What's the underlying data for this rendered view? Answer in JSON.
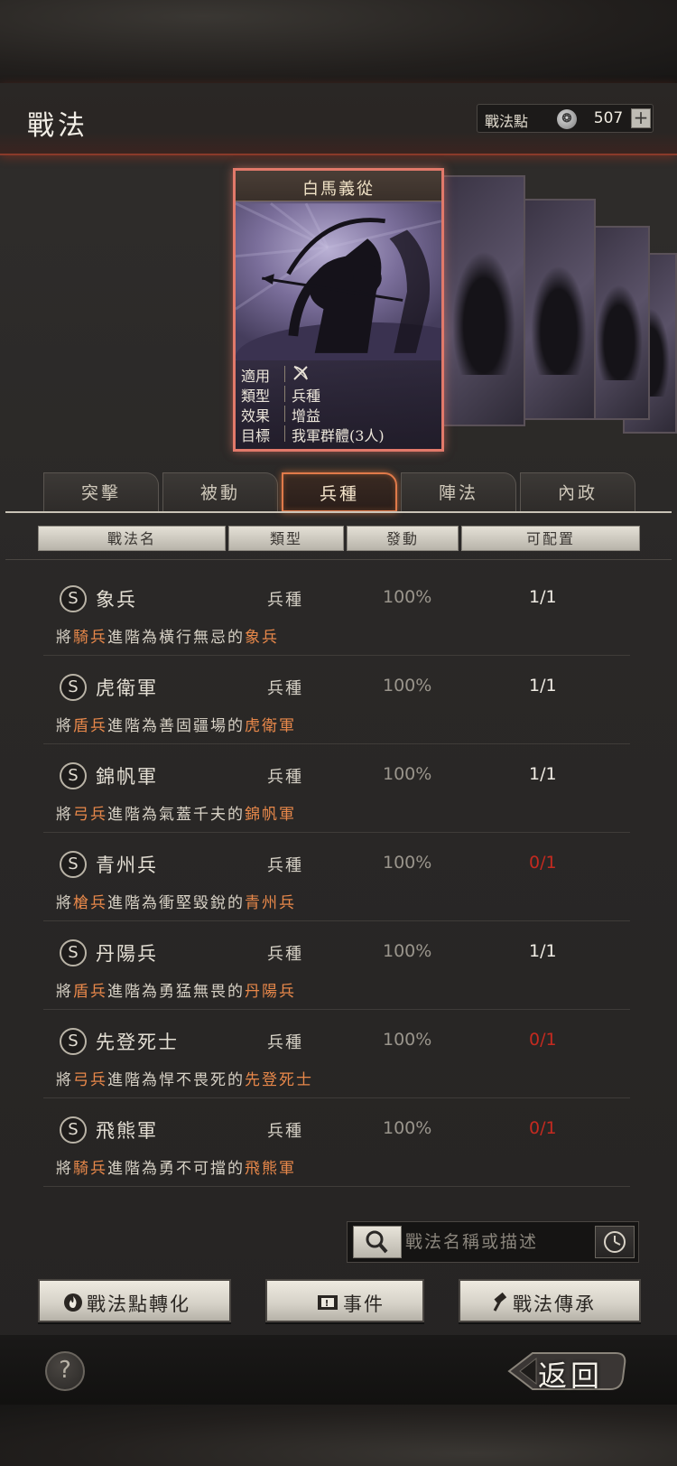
{
  "header": {
    "title": "戰法",
    "points_label": "戰法點",
    "points_value": "507",
    "add_label": "+"
  },
  "card": {
    "name": "白馬義從",
    "info": [
      {
        "key": "適用",
        "value": ""
      },
      {
        "key": "類型",
        "value": "兵種"
      },
      {
        "key": "效果",
        "value": "增益"
      },
      {
        "key": "目標",
        "value": "我軍群體(3人)"
      }
    ]
  },
  "tabs": [
    {
      "label": "突擊"
    },
    {
      "label": "被動"
    },
    {
      "label": "兵種"
    },
    {
      "label": "陣法"
    },
    {
      "label": "內政"
    }
  ],
  "columns": {
    "name": "戰法名",
    "type": "類型",
    "trigger": "發動",
    "configurable": "可配置"
  },
  "items": [
    {
      "grade": "S",
      "name": "象兵",
      "type": "兵種",
      "rate": "100%",
      "count": "1/1",
      "desc": [
        "將",
        "騎兵",
        "進階為橫行無忌的",
        "象兵",
        ""
      ]
    },
    {
      "grade": "S",
      "name": "虎衛軍",
      "type": "兵種",
      "rate": "100%",
      "count": "1/1",
      "desc": [
        "將",
        "盾兵",
        "進階為善固疆場的",
        "虎衛軍",
        ""
      ]
    },
    {
      "grade": "S",
      "name": "錦帆軍",
      "type": "兵種",
      "rate": "100%",
      "count": "1/1",
      "desc": [
        "將",
        "弓兵",
        "進階為氣蓋千夫的",
        "錦帆軍",
        ""
      ]
    },
    {
      "grade": "S",
      "name": "青州兵",
      "type": "兵種",
      "rate": "100%",
      "count": "0/1",
      "desc": [
        "將",
        "槍兵",
        "進階為衝堅毀銳的",
        "青州兵",
        ""
      ]
    },
    {
      "grade": "S",
      "name": "丹陽兵",
      "type": "兵種",
      "rate": "100%",
      "count": "1/1",
      "desc": [
        "將",
        "盾兵",
        "進階為勇猛無畏的",
        "丹陽兵",
        ""
      ]
    },
    {
      "grade": "S",
      "name": "先登死士",
      "type": "兵種",
      "rate": "100%",
      "count": "0/1",
      "desc": [
        "將",
        "弓兵",
        "進階為悍不畏死的",
        "先登死士",
        ""
      ]
    },
    {
      "grade": "S",
      "name": "飛熊軍",
      "type": "兵種",
      "rate": "100%",
      "count": "0/1",
      "desc": [
        "將",
        "騎兵",
        "進階為勇不可擋的",
        "飛熊軍",
        ""
      ]
    }
  ],
  "search": {
    "placeholder": "戰法名稱或描述"
  },
  "buttons": {
    "convert": "戰法點轉化",
    "event": "事件",
    "inherit": "戰法傳承",
    "back": "返回",
    "help": "?"
  },
  "colors": {
    "accent": "#e8884a",
    "active_tab": "#e07a4a",
    "zero_count": "#c42a20",
    "card_border": "#e2796a"
  },
  "icons": {
    "coin": "coin-icon",
    "search": "magnifier-icon",
    "history": "clock-icon",
    "convert": "flame-icon",
    "event": "scroll-icon",
    "inherit": "hammer-icon",
    "applicable": "bow-icon"
  }
}
